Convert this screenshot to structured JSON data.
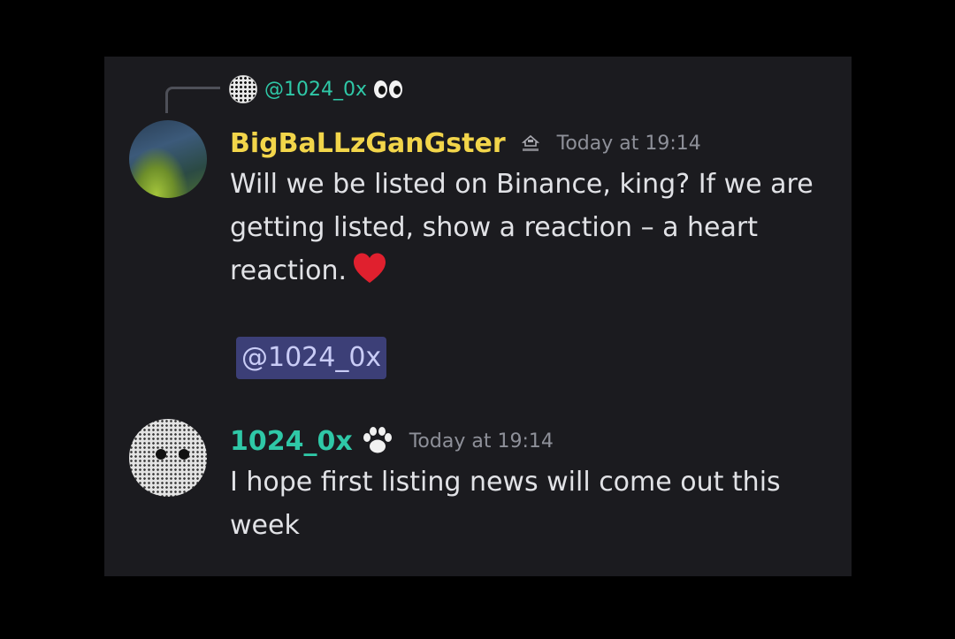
{
  "reply_reference": {
    "name": "@1024_0x",
    "icon": "eyes-emoji-icon"
  },
  "messages": [
    {
      "username": "BigBaLLzGanGster",
      "username_color": "#f2d54a",
      "badge_icon": "server-tag-badge-icon",
      "timestamp": "Today at 19:14",
      "text": "Will we be listed on Binance, king? If we are getting listed, show a reaction – a heart reaction.",
      "emoji": "red-heart-icon",
      "mention": "@1024_0x"
    },
    {
      "username": "1024_0x",
      "username_color": "#2fc8a7",
      "badge_icon": "paw-print-icon",
      "timestamp": "Today at 19:14",
      "text": "I hope first listing news will come out this week"
    }
  ],
  "colors": {
    "background": "#000000",
    "panel": "#1b1b1f",
    "mention_bg": "#3c3f77",
    "heart": "#e0202e"
  }
}
